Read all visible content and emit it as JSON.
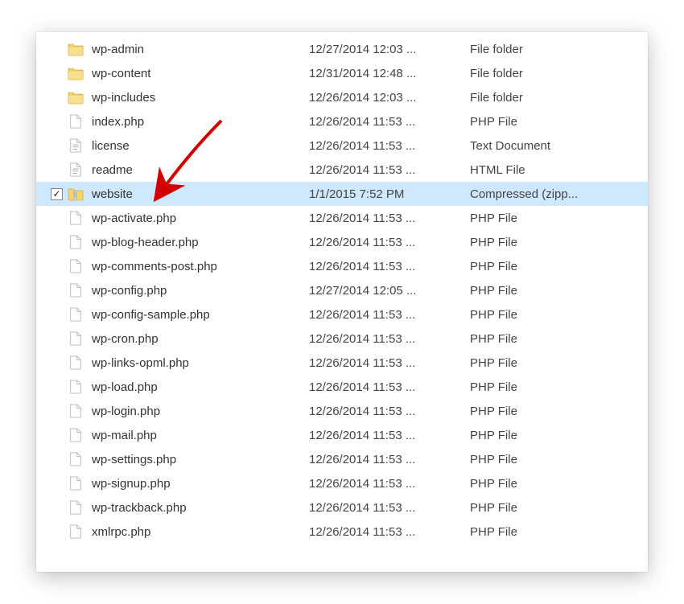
{
  "checkbox_check_glyph": "✓",
  "files": [
    {
      "icon": "folder",
      "name": "wp-admin",
      "date": "12/27/2014 12:03 ...",
      "type": "File folder",
      "selected": false
    },
    {
      "icon": "folder",
      "name": "wp-content",
      "date": "12/31/2014 12:48 ...",
      "type": "File folder",
      "selected": false
    },
    {
      "icon": "folder",
      "name": "wp-includes",
      "date": "12/26/2014 12:03 ...",
      "type": "File folder",
      "selected": false
    },
    {
      "icon": "file",
      "name": "index.php",
      "date": "12/26/2014 11:53 ...",
      "type": "PHP File",
      "selected": false
    },
    {
      "icon": "text",
      "name": "license",
      "date": "12/26/2014 11:53 ...",
      "type": "Text Document",
      "selected": false
    },
    {
      "icon": "text",
      "name": "readme",
      "date": "12/26/2014 11:53 ...",
      "type": "HTML File",
      "selected": false
    },
    {
      "icon": "zip",
      "name": "website",
      "date": "1/1/2015 7:52 PM",
      "type": "Compressed (zipp...",
      "selected": true
    },
    {
      "icon": "file",
      "name": "wp-activate.php",
      "date": "12/26/2014 11:53 ...",
      "type": "PHP File",
      "selected": false
    },
    {
      "icon": "file",
      "name": "wp-blog-header.php",
      "date": "12/26/2014 11:53 ...",
      "type": "PHP File",
      "selected": false
    },
    {
      "icon": "file",
      "name": "wp-comments-post.php",
      "date": "12/26/2014 11:53 ...",
      "type": "PHP File",
      "selected": false
    },
    {
      "icon": "file",
      "name": "wp-config.php",
      "date": "12/27/2014 12:05 ...",
      "type": "PHP File",
      "selected": false
    },
    {
      "icon": "file",
      "name": "wp-config-sample.php",
      "date": "12/26/2014 11:53 ...",
      "type": "PHP File",
      "selected": false
    },
    {
      "icon": "file",
      "name": "wp-cron.php",
      "date": "12/26/2014 11:53 ...",
      "type": "PHP File",
      "selected": false
    },
    {
      "icon": "file",
      "name": "wp-links-opml.php",
      "date": "12/26/2014 11:53 ...",
      "type": "PHP File",
      "selected": false
    },
    {
      "icon": "file",
      "name": "wp-load.php",
      "date": "12/26/2014 11:53 ...",
      "type": "PHP File",
      "selected": false
    },
    {
      "icon": "file",
      "name": "wp-login.php",
      "date": "12/26/2014 11:53 ...",
      "type": "PHP File",
      "selected": false
    },
    {
      "icon": "file",
      "name": "wp-mail.php",
      "date": "12/26/2014 11:53 ...",
      "type": "PHP File",
      "selected": false
    },
    {
      "icon": "file",
      "name": "wp-settings.php",
      "date": "12/26/2014 11:53 ...",
      "type": "PHP File",
      "selected": false
    },
    {
      "icon": "file",
      "name": "wp-signup.php",
      "date": "12/26/2014 11:53 ...",
      "type": "PHP File",
      "selected": false
    },
    {
      "icon": "file",
      "name": "wp-trackback.php",
      "date": "12/26/2014 11:53 ...",
      "type": "PHP File",
      "selected": false
    },
    {
      "icon": "file",
      "name": "xmlrpc.php",
      "date": "12/26/2014 11:53 ...",
      "type": "PHP File",
      "selected": false
    }
  ]
}
